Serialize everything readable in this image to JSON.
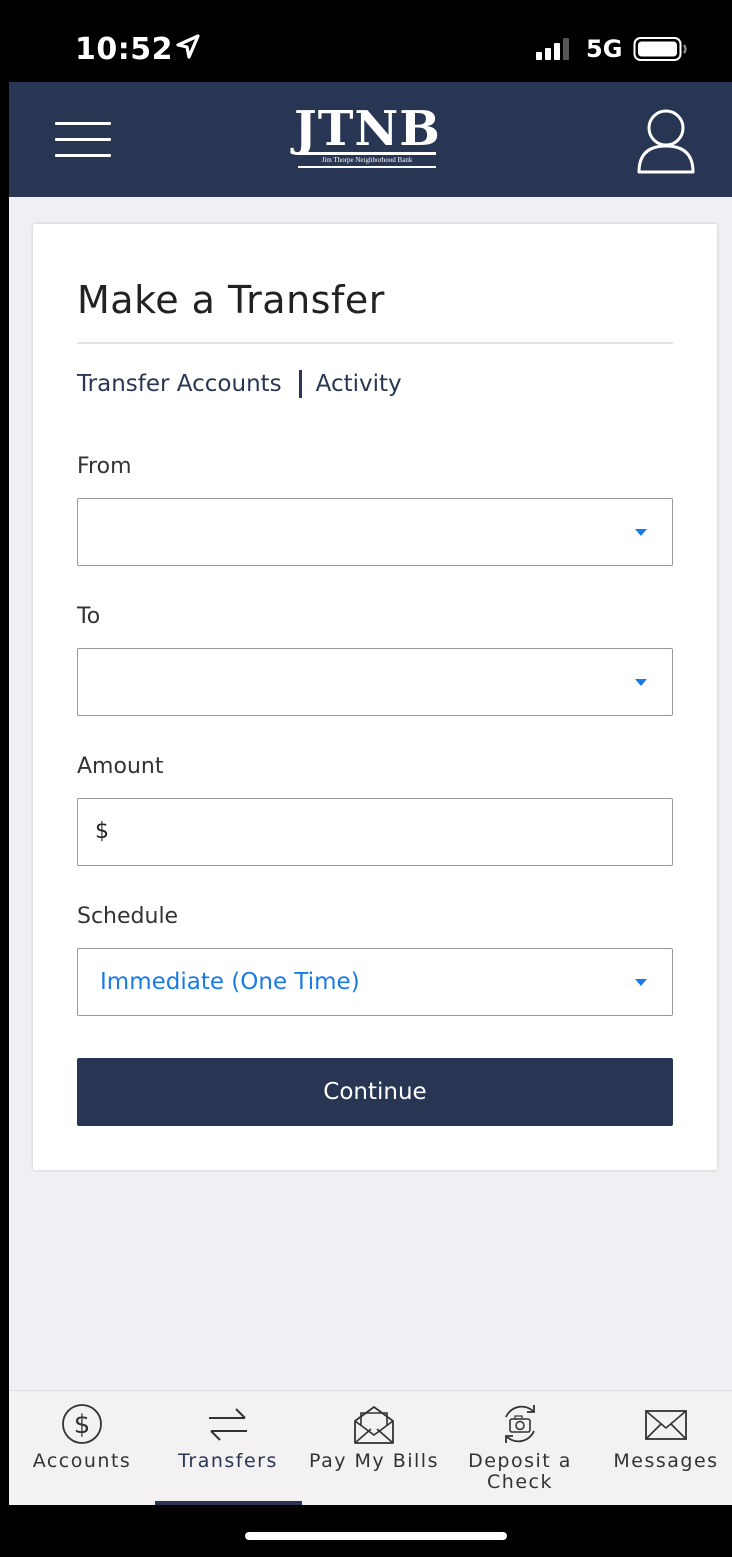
{
  "status_bar": {
    "time": "10:52",
    "network": "5G"
  },
  "header": {
    "menu_icon": "hamburger-menu-icon",
    "logo_main": "JTNB",
    "logo_sub": "Jim Thorpe Neighborhood Bank",
    "profile_icon": "user-profile-icon",
    "background": "#283654"
  },
  "page": {
    "title": "Make a Transfer",
    "subnav": {
      "transfer_accounts": "Transfer Accounts",
      "activity": "Activity"
    },
    "fields": {
      "from_label": "From",
      "from_value": "",
      "to_label": "To",
      "to_value": "",
      "amount_label": "Amount",
      "amount_prefix": "$",
      "amount_value": "",
      "schedule_label": "Schedule",
      "schedule_value": "Immediate (One Time)"
    },
    "continue_label": "Continue",
    "accent_color": "#1a7be6"
  },
  "tab_bar": {
    "items": [
      {
        "label": "Accounts",
        "icon": "dollar-circle-icon",
        "active": false
      },
      {
        "label": "Transfers",
        "icon": "arrows-swap-icon",
        "active": true
      },
      {
        "label": "Pay My Bills",
        "icon": "open-envelope-icon",
        "active": false
      },
      {
        "label": "Deposit a Check",
        "icon": "camera-refresh-icon",
        "active": false
      },
      {
        "label": "Messages",
        "icon": "envelope-icon",
        "active": false
      }
    ]
  }
}
